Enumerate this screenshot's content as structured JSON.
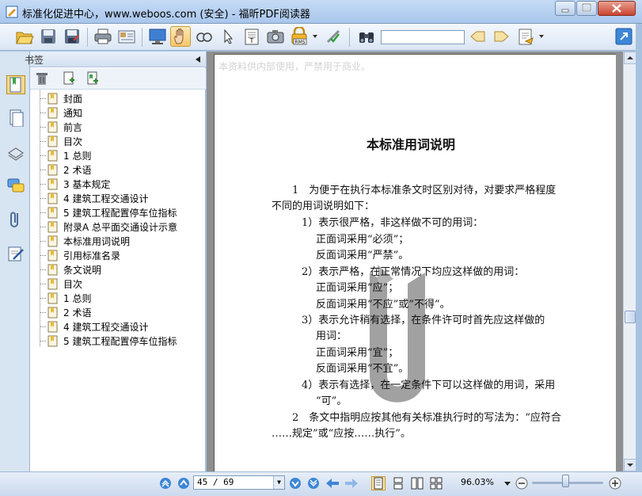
{
  "window": {
    "title": "标准化促进中心，www.weboos.com (安全) - 福昕PDF阅读器"
  },
  "toolbar": {
    "search_placeholder": "",
    "search_value": "",
    "icons": [
      "open-icon",
      "save-icon",
      "save-as-icon",
      "print-icon",
      "email-icon",
      "fullscreen-icon",
      "hand-icon",
      "zoom-select-icon",
      "select-arrow-icon",
      "text-select-icon",
      "snapshot-icon",
      "rms-lock-icon",
      "sign-icon",
      "find-icon",
      "prev-result-icon",
      "next-result-icon",
      "annotate-icon",
      "expand-icon"
    ]
  },
  "bookmarks": {
    "header": "书签",
    "items": [
      {
        "label": "封面"
      },
      {
        "label": "通知"
      },
      {
        "label": "前言"
      },
      {
        "label": "目次"
      },
      {
        "label": "1 总则"
      },
      {
        "label": "2 术语"
      },
      {
        "label": "3 基本规定"
      },
      {
        "label": "4 建筑工程交通设计"
      },
      {
        "label": "5 建筑工程配置停车位指标"
      },
      {
        "label": "附录A 总平面交通设计示意"
      },
      {
        "label": "本标准用词说明"
      },
      {
        "label": "引用标准名录"
      },
      {
        "label": "条文说明"
      },
      {
        "label": "目次"
      },
      {
        "label": "1 总则"
      },
      {
        "label": "2 术语"
      },
      {
        "label": "4 建筑工程交通设计"
      },
      {
        "label": "5 建筑工程配置停车位指标"
      }
    ]
  },
  "document": {
    "watermark": "本资料供内部使用，严禁用于商业。",
    "title": "本标准用词说明",
    "lines": [
      "1　为便于在执行本标准条文时区别对待，对要求严格程度",
      "不同的用词说明如下：",
      "1）表示很严格，非这样做不可的用词：",
      "正面词采用“必须”；",
      "反面词采用“严禁”。",
      "2）表示严格，在正常情况下均应这样做的用词：",
      "正面词采用“应”；",
      "反面词采用“不应”或“不得”。",
      "3）表示允许稍有选择，在条件许可时首先应这样做的",
      "用词：",
      "正面词采用“宜”；",
      "反面词采用“不宜”。",
      "4）表示有选择，在一定条件下可以这样做的用词，采用",
      "“可”。",
      "2　条文中指明应按其他有关标准执行时的写法为：“应符合",
      "……规定”或“应按……执行”。"
    ]
  },
  "statusbar": {
    "page_indicator": "45 / 69",
    "zoom": "96.03%"
  }
}
